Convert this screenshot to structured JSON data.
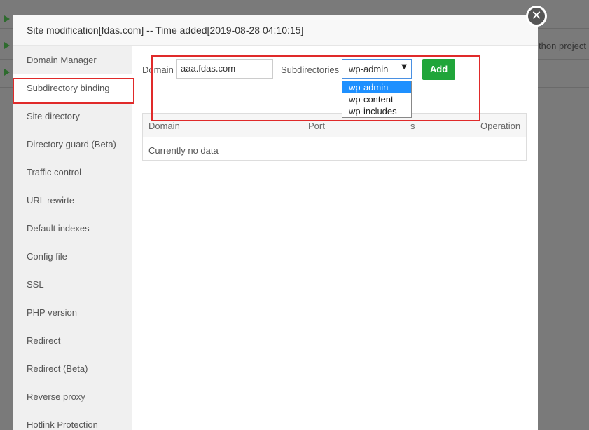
{
  "background": {
    "rows": 3,
    "partial_text": "thon project"
  },
  "modal": {
    "title": "Site modification[fdas.com] -- Time added[2019-08-28 04:10:15]",
    "close_icon": "close-icon"
  },
  "sidebar": {
    "items": [
      {
        "label": "Domain Manager"
      },
      {
        "label": "Subdirectory binding",
        "active": true
      },
      {
        "label": "Site directory"
      },
      {
        "label": "Directory guard (Beta)"
      },
      {
        "label": "Traffic control"
      },
      {
        "label": "URL rewirte"
      },
      {
        "label": "Default indexes"
      },
      {
        "label": "Config file"
      },
      {
        "label": "SSL"
      },
      {
        "label": "PHP version"
      },
      {
        "label": "Redirect"
      },
      {
        "label": "Redirect (Beta)"
      },
      {
        "label": "Reverse proxy"
      },
      {
        "label": "Hotlink Protection"
      }
    ]
  },
  "form": {
    "domain_label": "Domain",
    "domain_value": "aaa.fdas.com",
    "subdir_label": "Subdirectories",
    "subdir_selected": "wp-admin",
    "subdir_options": [
      "wp-admin",
      "wp-content",
      "wp-includes"
    ],
    "add_label": "Add"
  },
  "table": {
    "headers": [
      "Domain",
      "Port",
      "s",
      "Operation"
    ],
    "empty_text": "Currently no data"
  },
  "colors": {
    "accent_green": "#20a53a",
    "highlight_red": "#e02a2a",
    "selected_blue": "#1e90ff"
  }
}
